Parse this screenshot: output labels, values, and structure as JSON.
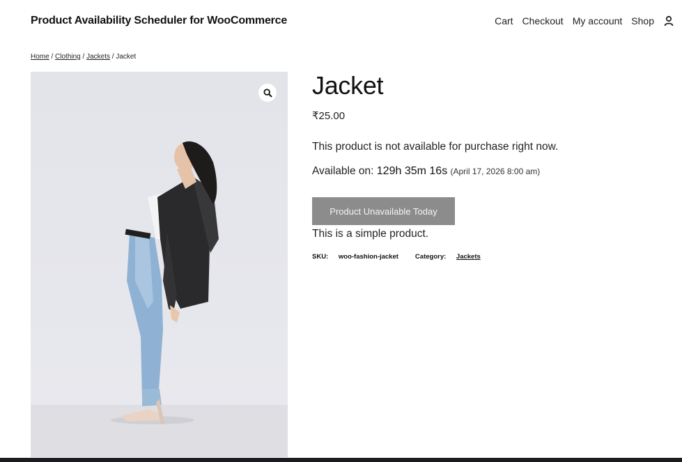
{
  "site": {
    "title": "Product Availability Scheduler for WooCommerce"
  },
  "nav": {
    "items": [
      "Cart",
      "Checkout",
      "My account",
      "Shop"
    ],
    "account_icon": "user-icon"
  },
  "breadcrumb": {
    "home": "Home",
    "sep": " / ",
    "clothing": "Clothing",
    "jackets": "Jackets",
    "current": "Jacket"
  },
  "product": {
    "title": "Jacket",
    "price": "₹25.00",
    "notice": "This product is not available for purchase right now.",
    "available_label": "Available on: ",
    "countdown": "129h 35m 16s",
    "available_date": "(April 17, 2026 8:00 am)",
    "button_label": "Product Unavailable Today",
    "short_description": "This is a simple product.",
    "sku_label": "SKU: ",
    "sku": "woo-fashion-jacket",
    "category_label": "Category: ",
    "category": "Jackets",
    "zoom_icon": "magnifier-icon"
  },
  "colors": {
    "button_bg": "#8c8c8c",
    "image_bg": "#e4e5ea",
    "bottom_bar": "#1d1b1f"
  }
}
